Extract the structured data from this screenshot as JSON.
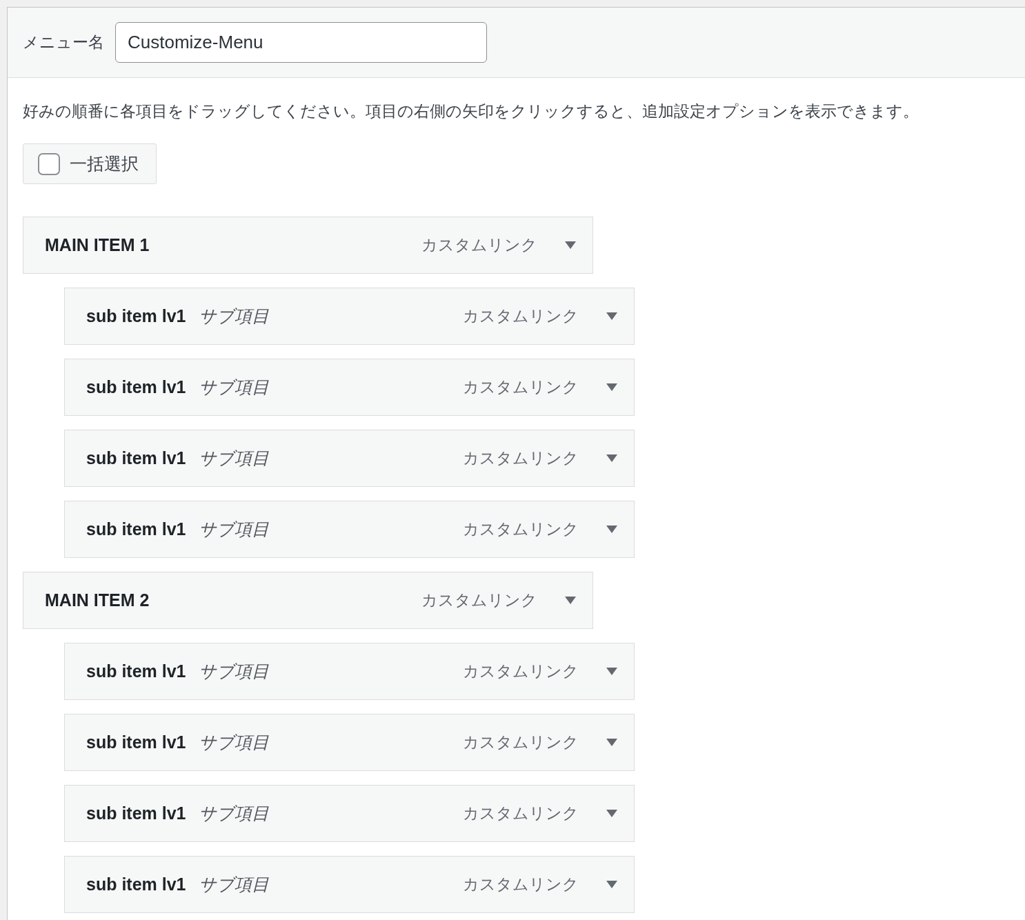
{
  "menu_name": {
    "label": "メニュー名",
    "value": "Customize-Menu"
  },
  "instructions": "好みの順番に各項目をドラッグしてください。項目の右側の矢印をクリックすると、追加設定オプションを表示できます。",
  "bulk_select": {
    "label": "一括選択",
    "checked": false
  },
  "menu_items": [
    {
      "title": "MAIN ITEM 1",
      "type": "カスタムリンク",
      "children": [
        {
          "title": "sub item lv1",
          "note": "サブ項目",
          "type": "カスタムリンク"
        },
        {
          "title": "sub item lv1",
          "note": "サブ項目",
          "type": "カスタムリンク"
        },
        {
          "title": "sub item lv1",
          "note": "サブ項目",
          "type": "カスタムリンク"
        },
        {
          "title": "sub item lv1",
          "note": "サブ項目",
          "type": "カスタムリンク"
        }
      ]
    },
    {
      "title": "MAIN ITEM 2",
      "type": "カスタムリンク",
      "children": [
        {
          "title": "sub item lv1",
          "note": "サブ項目",
          "type": "カスタムリンク"
        },
        {
          "title": "sub item lv1",
          "note": "サブ項目",
          "type": "カスタムリンク"
        },
        {
          "title": "sub item lv1",
          "note": "サブ項目",
          "type": "カスタムリンク"
        },
        {
          "title": "sub item lv1",
          "note": "サブ項目",
          "type": "カスタムリンク"
        }
      ]
    }
  ]
}
